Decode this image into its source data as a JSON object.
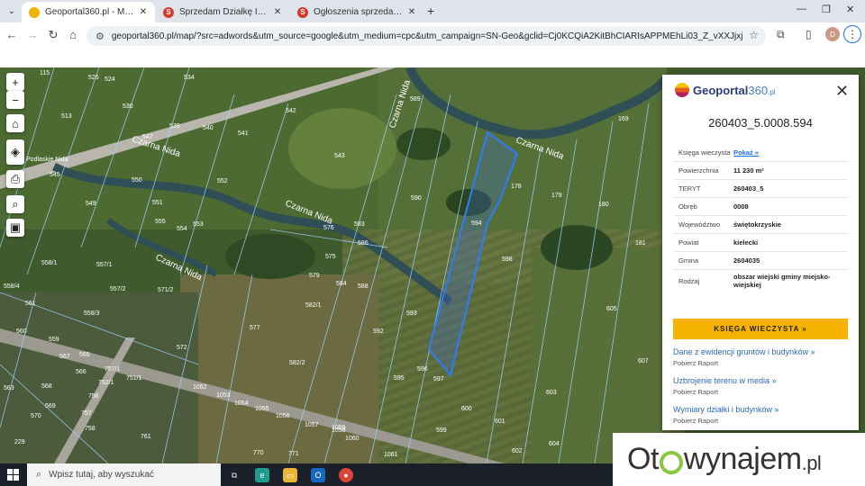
{
  "browser": {
    "tabs": [
      {
        "label": "Geoportal360.pl - Mapa Interaktywna",
        "favicon_color": "#f0b400",
        "active": true
      },
      {
        "label": "Sprzedam Działkę Inwestycyjną",
        "favicon_color": "#d33c2b",
        "active": false
      },
      {
        "label": "Ogłoszenia sprzedam, kupię - Sprzedajemy.pl",
        "favicon_color": "#d33c2b",
        "active": false
      }
    ],
    "url": "geoportal360.pl/map/?src=adwords&utm_source=google&utm_medium=cpc&utm_campaign=SN-Geo&gclid=Cj0KCQiA2KitBhCIARIsAPPMEhLi03_Z_vXXJjxjtzfgnxd5x51eWlqGcdul...",
    "profile_initial": "D"
  },
  "map": {
    "parcels": [
      {
        "label": "115"
      },
      {
        "label": "526"
      },
      {
        "label": "524"
      },
      {
        "label": "534"
      },
      {
        "label": "530"
      },
      {
        "label": "513"
      },
      {
        "label": "539"
      },
      {
        "label": "540"
      },
      {
        "label": "542"
      },
      {
        "label": "547"
      },
      {
        "label": "541"
      },
      {
        "label": "545"
      },
      {
        "label": "543"
      },
      {
        "label": "550"
      },
      {
        "label": "552"
      },
      {
        "label": "549"
      },
      {
        "label": "551"
      },
      {
        "label": "553"
      },
      {
        "label": "555"
      },
      {
        "label": "554"
      },
      {
        "label": "576"
      },
      {
        "label": "583"
      },
      {
        "label": "586"
      },
      {
        "label": "575"
      },
      {
        "label": "579"
      },
      {
        "label": "584"
      },
      {
        "label": "588"
      },
      {
        "label": "582/1"
      },
      {
        "label": "577"
      },
      {
        "label": "572"
      },
      {
        "label": "582/2"
      },
      {
        "label": "571/2"
      },
      {
        "label": "557/1"
      },
      {
        "label": "557/2"
      },
      {
        "label": "558/1"
      },
      {
        "label": "558/4"
      },
      {
        "label": "558/3"
      },
      {
        "label": "589"
      },
      {
        "label": "590"
      },
      {
        "label": "594"
      },
      {
        "label": "178"
      },
      {
        "label": "179"
      },
      {
        "label": "180"
      },
      {
        "label": "169"
      },
      {
        "label": "181"
      },
      {
        "label": "598"
      },
      {
        "label": "593"
      },
      {
        "label": "592"
      },
      {
        "label": "596"
      },
      {
        "label": "595"
      },
      {
        "label": "597"
      },
      {
        "label": "600"
      },
      {
        "label": "599"
      },
      {
        "label": "601"
      },
      {
        "label": "602"
      },
      {
        "label": "603"
      },
      {
        "label": "604"
      },
      {
        "label": "605"
      },
      {
        "label": "607"
      },
      {
        "label": "1052"
      },
      {
        "label": "1053"
      },
      {
        "label": "1054"
      },
      {
        "label": "1055"
      },
      {
        "label": "1056"
      },
      {
        "label": "1057"
      },
      {
        "label": "1058"
      },
      {
        "label": "1059"
      },
      {
        "label": "1060"
      },
      {
        "label": "1061"
      },
      {
        "label": "770"
      },
      {
        "label": "771"
      },
      {
        "label": "761"
      },
      {
        "label": "757/1"
      },
      {
        "label": "756"
      },
      {
        "label": "752/1"
      },
      {
        "label": "751/1"
      },
      {
        "label": "566"
      },
      {
        "label": "565"
      },
      {
        "label": "567"
      },
      {
        "label": "563"
      },
      {
        "label": "568"
      },
      {
        "label": "569"
      },
      {
        "label": "570"
      },
      {
        "label": "229"
      },
      {
        "label": "757"
      },
      {
        "label": "758"
      },
      {
        "label": "559"
      },
      {
        "label": "560"
      },
      {
        "label": "561"
      }
    ],
    "river_labels": [
      "Czarna Nida",
      "Czarna Nida",
      "Czarna Nida",
      "Czarna Nida",
      "Czarna Nida"
    ],
    "place_labels": [
      "Kajaki Podlaskie Nida",
      "Kajaki&Chillout"
    ],
    "selected_parcel": "594"
  },
  "panel": {
    "brand": "Geoportal",
    "brand_num": "360",
    "brand_tld": ".pl",
    "parcel_id": "260403_5.0008.594",
    "rows": [
      {
        "key": "Księga wieczysta",
        "value": "Pokaż »",
        "link": true
      },
      {
        "key": "Powierzchnia",
        "value": "11 230 m²",
        "link": false
      },
      {
        "key": "TERYT",
        "value": "260403_5",
        "link": false
      },
      {
        "key": "Obręb",
        "value": "0008",
        "link": false
      },
      {
        "key": "Województwo",
        "value": "świętokrzyskie",
        "link": false
      },
      {
        "key": "Powiat",
        "value": "kielecki",
        "link": false
      },
      {
        "key": "Gmina",
        "value": "2604035",
        "link": false
      },
      {
        "key": "Rodzaj",
        "value": "obszar wiejski gminy miejsko-wiejskiej",
        "link": false
      }
    ],
    "kw_button": "KSIĘGA WIECZYSTA »",
    "reports": [
      {
        "title": "Dane z ewidencji gruntów i budynków »",
        "sub": "Pobierz Raport"
      },
      {
        "title": "Uzbrojenie terenu w media »",
        "sub": "Pobierz Raport"
      },
      {
        "title": "Wymiary działki i budynków »",
        "sub": "Pobierz Raport"
      }
    ]
  },
  "taskbar": {
    "search_placeholder": "Wpisz tutaj, aby wyszukać"
  },
  "watermark": {
    "part1": "Ot",
    "part2": "wynajem",
    "part3": ".pl"
  }
}
